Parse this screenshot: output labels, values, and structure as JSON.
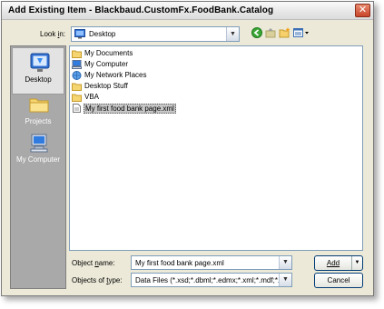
{
  "window": {
    "title": "Add Existing Item - Blackbaud.CustomFx.FoodBank.Catalog",
    "close_symbol": "✕"
  },
  "lookin": {
    "label": "Look in:",
    "value": "Desktop"
  },
  "toolbar": {
    "back_icon": "back-icon",
    "up_icon": "up-folder-icon",
    "new_folder_icon": "new-folder-icon",
    "views_icon": "views-icon"
  },
  "places": [
    {
      "label": "Desktop",
      "icon": "desktop-icon",
      "active": true
    },
    {
      "label": "Projects",
      "icon": "folder-icon",
      "active": false
    },
    {
      "label": "My Computer",
      "icon": "my-computer-icon",
      "active": false
    }
  ],
  "files": [
    {
      "name": "My Documents",
      "icon": "folder-icon"
    },
    {
      "name": "My Computer",
      "icon": "my-computer-icon"
    },
    {
      "name": "My Network Places",
      "icon": "network-icon"
    },
    {
      "name": "Desktop Stuff",
      "icon": "folder-icon"
    },
    {
      "name": "VBA",
      "icon": "folder-icon"
    },
    {
      "name": "My first food bank page.xml",
      "icon": "xml-file-icon",
      "selected": true
    }
  ],
  "object_name": {
    "label": "Object name:",
    "value": "My first food bank page.xml"
  },
  "object_type": {
    "label": "Objects of type:",
    "value": "Data Files (*.xsd;*.dbml;*.edmx;*.xml;*.mdf;*.mdb"
  },
  "buttons": {
    "add": "Add",
    "cancel": "Cancel"
  }
}
